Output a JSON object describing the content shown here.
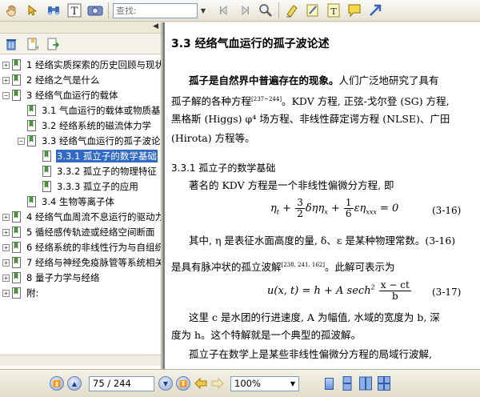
{
  "toolbar": {
    "icons": [
      "hand-tool-icon",
      "select-arrow-icon",
      "binoculars-icon",
      "text-tool-icon",
      "snapshot-icon",
      "bookmark-add-icon",
      "note-icon",
      "text-box-icon",
      "comment-icon",
      "arrow-tool-icon"
    ],
    "search_placeholder": "查找:"
  },
  "left_panel": {
    "tools": [
      "delete-icon",
      "new-bookmark-icon",
      "export-icon"
    ],
    "tree": [
      {
        "label": "1  经络实质探索的历史回顾与现状",
        "level": 0,
        "expanded": false,
        "has_children": true
      },
      {
        "label": "2  经络之气是什么",
        "level": 0,
        "expanded": false,
        "has_children": true
      },
      {
        "label": "3  经络气血运行的载体",
        "level": 0,
        "expanded": true,
        "has_children": true
      },
      {
        "label": "3.1  气血运行的载体或物质基础",
        "level": 1,
        "expanded": false,
        "has_children": false
      },
      {
        "label": "3.2  经络系统的磁流体力学",
        "level": 1,
        "expanded": false,
        "has_children": false
      },
      {
        "label": "3.3  经络气血运行的孤子波论述",
        "level": 1,
        "expanded": true,
        "has_children": true
      },
      {
        "label": "3.3.1  孤立子的数学基础",
        "level": 2,
        "expanded": false,
        "has_children": false,
        "selected": true
      },
      {
        "label": "3.3.2  孤立子的物理特征",
        "level": 2,
        "expanded": false,
        "has_children": false
      },
      {
        "label": "3.3.3  孤立子的应用",
        "level": 2,
        "expanded": false,
        "has_children": false
      },
      {
        "label": "3.4  生物等离子体",
        "level": 1,
        "expanded": false,
        "has_children": false
      },
      {
        "label": "4  经络气血周流不息运行的驱动力",
        "level": 0,
        "expanded": false,
        "has_children": true
      },
      {
        "label": "5  循经感传轨迹或经络空间断面",
        "level": 0,
        "expanded": false,
        "has_children": true
      },
      {
        "label": "6  经络系统的非线性行为与自组织",
        "level": 0,
        "expanded": false,
        "has_children": true
      },
      {
        "label": "7  经络与神经免疫脉管等系统相关",
        "level": 0,
        "expanded": false,
        "has_children": true
      },
      {
        "label": "8  量子力学与经络",
        "level": 0,
        "expanded": false,
        "has_children": true
      },
      {
        "label": "附:",
        "level": 0,
        "expanded": false,
        "has_children": true
      }
    ]
  },
  "document": {
    "section_title": "3.3   经络气血运行的孤子波论述",
    "para1_bold": "孤子是自然界中普遍存在的现象。",
    "para1_rest_a": "人们广泛地研究了具有",
    "para1_line2": "孤子解的各种方程",
    "para1_cite": "[237~244]",
    "para1_line2_rest": "。KDV 方程, 正弦-戈尔登 (SG) 方程,",
    "para1_line3": "黑格斯 (Higgs) φ⁴ 场方程、非线性薛定谔方程 (NLSE)、广田",
    "para1_line4": "(Hirota) 方程等。",
    "subsection_title": "3.3.1    孤立子的数学基础",
    "para2": "著名的 KDV 方程是一个非线性偏微分方程, 即",
    "eq1_no": "(3-16)",
    "para3_line1": "其中, η 是表征水面高度的量, δ、ε 是某种物理常数。(3-16)",
    "para3_line2": "是具有脉冲状的孤立波解",
    "para3_cite": "[238, 241, 162]",
    "para3_line2_rest": "。此解可表示为",
    "eq2_no": "(3-17)",
    "para4_line1": "这里 c 是水团的行进速度, A 为幅值, 水域的宽度为 b, 深",
    "para4_line2": "度为 h。这个特解就是一个典型的孤波解。",
    "para5_line1": "孤立子在数学上是某些非线性偏微分方程的局域行波解,"
  },
  "statusbar": {
    "page": "75 / 244",
    "zoom": "100%"
  }
}
